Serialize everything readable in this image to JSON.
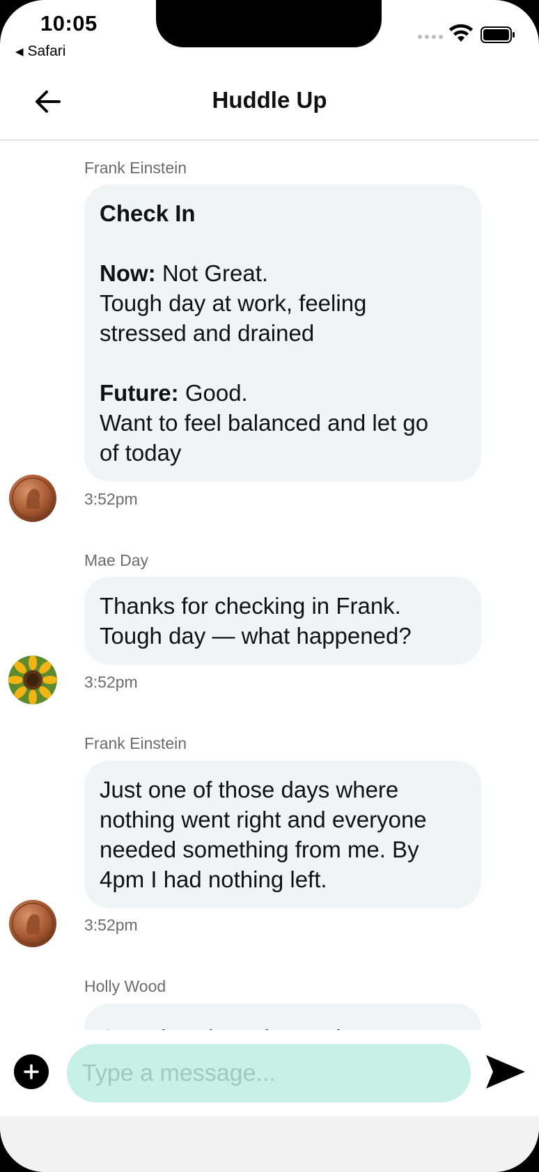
{
  "status_bar": {
    "time": "10:05",
    "back_app": "Safari",
    "back_app_icon": "back-triangle-icon"
  },
  "header": {
    "title": "Huddle Up",
    "back_icon": "arrow-left-icon"
  },
  "messages": [
    {
      "sender": "Frank Einstein",
      "title": "Check In",
      "now_label": "Now:",
      "now_value": "Not Great.",
      "now_text_line1": "Tough day at work, feeling",
      "now_text_line2": "stressed and drained",
      "future_label": "Future:",
      "future_value": "Good.",
      "future_text_line1": "Want to feel balanced and let go",
      "future_text_line2": "of today",
      "time": "3:52pm",
      "avatar": "penny-avatar"
    },
    {
      "sender": "Mae Day",
      "text_line1": "Thanks for checking in Frank.",
      "text_line2": "Tough day — what happened?",
      "time": "3:52pm",
      "avatar": "sunflower-avatar"
    },
    {
      "sender": "Frank Einstein",
      "text_line1": "Just one of those days where",
      "text_line2": "nothing went right and everyone",
      "text_line3": "needed something from me. By",
      "text_line4": "4pm I had nothing left.",
      "time": "3:52pm",
      "avatar": "penny-avatar"
    },
    {
      "sender": "Holly Wood",
      "text_line1": "Sounds exhausting. Being"
    }
  ],
  "composer": {
    "placeholder": "Type a message...",
    "add_icon": "plus-icon",
    "send_icon": "send-icon"
  }
}
